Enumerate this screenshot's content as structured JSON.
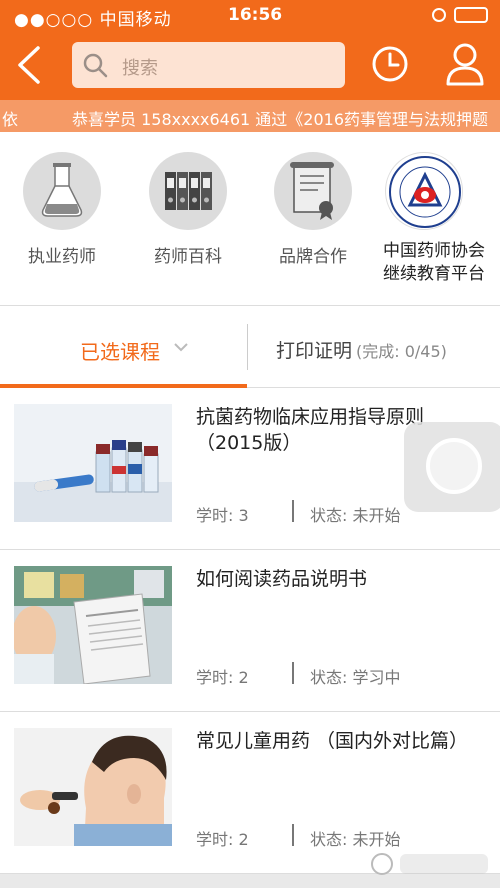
{
  "status_bar": {
    "carrier": "●●○○○ 中国移动",
    "time": "16:56"
  },
  "nav": {
    "search_placeholder": "搜索"
  },
  "ticker": {
    "left_fragment": "依",
    "message": "恭喜学员 158xxxx6461 通过《2016药事管理与法规押题"
  },
  "categories": [
    {
      "label": "执业药师"
    },
    {
      "label": "药师百科"
    },
    {
      "label": "品牌合作"
    },
    {
      "label_line1": "中国药师协会",
      "label_line2": "继续教育平台"
    }
  ],
  "tabs": {
    "selected_label": "已选课程",
    "print_label": "打印证明",
    "print_progress": "(完成: 0/45)"
  },
  "courses": [
    {
      "title": "抗菌药物临床应用指导原则（2015版）",
      "hours": "学时: 3",
      "status": "状态: 未开始"
    },
    {
      "title": "如何阅读药品说明书",
      "hours": "学时: 2",
      "status": "状态: 学习中"
    },
    {
      "title": "常见儿童用药 （国内外对比篇）",
      "hours": "学时: 2",
      "status": "状态: 未开始"
    }
  ],
  "colors": {
    "brand": "#f26a1b",
    "ticker_bg": "#f59a66",
    "search_bg": "#fde3d3"
  }
}
